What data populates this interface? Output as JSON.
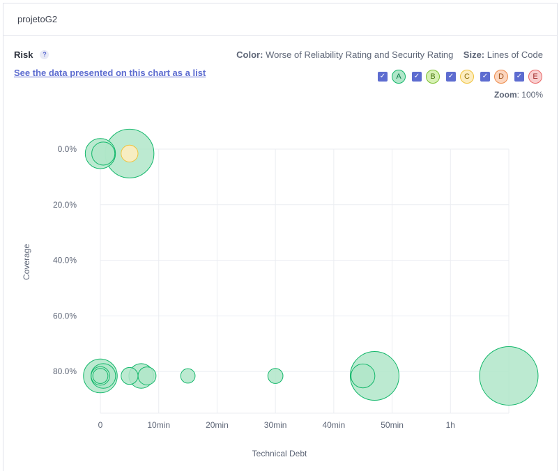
{
  "project": {
    "name": "projetoG2"
  },
  "risk": {
    "title": "Risk",
    "help": "?",
    "list_link": "See the data presented on this chart as a list",
    "color_label": "Color:",
    "color_value": "Worse of Reliability Rating and Security Rating",
    "size_label": "Size:",
    "size_value": "Lines of Code",
    "zoom_label": "Zoom",
    "zoom_value": ": 100%"
  },
  "legend": [
    {
      "label": "A",
      "checked": true,
      "fill": "#b0e6c9",
      "stroke": "#12b76a",
      "text": "#0a7a46"
    },
    {
      "label": "B",
      "checked": true,
      "fill": "#d7f0b4",
      "stroke": "#7bc02f",
      "text": "#4a7a12"
    },
    {
      "label": "C",
      "checked": true,
      "fill": "#fdedc0",
      "stroke": "#f0c23a",
      "text": "#8a6a00"
    },
    {
      "label": "D",
      "checked": true,
      "fill": "#fcd6bf",
      "stroke": "#ee8b4a",
      "text": "#9a4e15"
    },
    {
      "label": "E",
      "checked": true,
      "fill": "#f9cfcf",
      "stroke": "#e86666",
      "text": "#a12a2a"
    }
  ],
  "chart_data": {
    "type": "scatter",
    "xlabel": "Technical Debt",
    "ylabel": "Coverage",
    "x_unit": "minutes",
    "xlim": [
      0,
      70
    ],
    "ylim": [
      0,
      100
    ],
    "y_reversed": true,
    "grid": true,
    "x_ticks": [
      {
        "value": 0,
        "label": "0"
      },
      {
        "value": 10,
        "label": "10min"
      },
      {
        "value": 20,
        "label": "20min"
      },
      {
        "value": 30,
        "label": "30min"
      },
      {
        "value": 40,
        "label": "40min"
      },
      {
        "value": 50,
        "label": "50min"
      },
      {
        "value": 60,
        "label": "1h"
      }
    ],
    "y_ticks": [
      {
        "value": 0,
        "label": "0.0%"
      },
      {
        "value": 20,
        "label": "20.0%"
      },
      {
        "value": 40,
        "label": "40.0%"
      },
      {
        "value": 60,
        "label": "60.0%"
      },
      {
        "value": 80,
        "label": "80.0%"
      }
    ],
    "points": [
      {
        "x": 70,
        "y": 81.6,
        "size": 1800,
        "rating": "A"
      },
      {
        "x": 47,
        "y": 81.6,
        "size": 1250,
        "rating": "A"
      },
      {
        "x": 5,
        "y": 1.6,
        "size": 1250,
        "rating": "A"
      },
      {
        "x": 0,
        "y": 81.6,
        "size": 600,
        "rating": "A"
      },
      {
        "x": 0,
        "y": 1.6,
        "size": 480,
        "rating": "A"
      },
      {
        "x": 7,
        "y": 81.6,
        "size": 320,
        "rating": "A"
      },
      {
        "x": 45,
        "y": 81.6,
        "size": 300,
        "rating": "A"
      },
      {
        "x": 0.5,
        "y": 81.6,
        "size": 320,
        "rating": "A"
      },
      {
        "x": 0.5,
        "y": 1.6,
        "size": 280,
        "rating": "A"
      },
      {
        "x": 0,
        "y": 81.6,
        "size": 180,
        "rating": "A"
      },
      {
        "x": 8,
        "y": 81.6,
        "size": 170,
        "rating": "A"
      },
      {
        "x": 5,
        "y": 81.6,
        "size": 150,
        "rating": "A"
      },
      {
        "x": 5,
        "y": 1.6,
        "size": 150,
        "rating": "C"
      },
      {
        "x": 0,
        "y": 81.6,
        "size": 120,
        "rating": "A"
      },
      {
        "x": 15,
        "y": 81.6,
        "size": 110,
        "rating": "A"
      },
      {
        "x": 30,
        "y": 81.6,
        "size": 120,
        "rating": "A"
      }
    ]
  }
}
